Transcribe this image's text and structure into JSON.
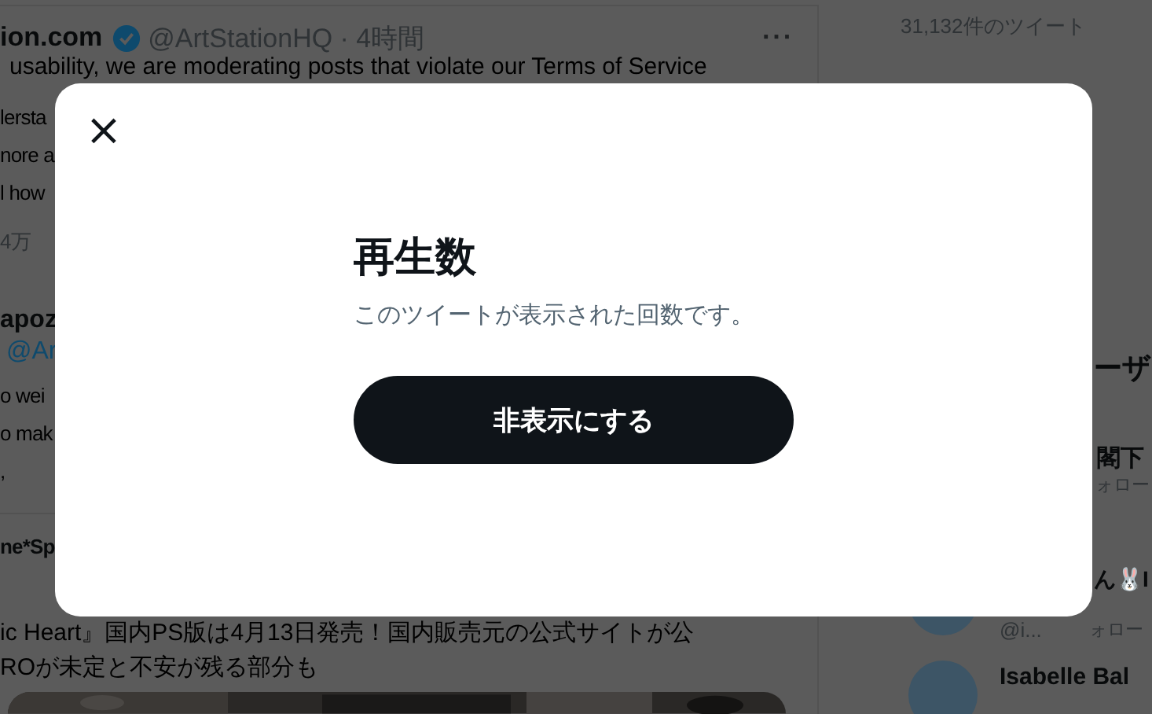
{
  "background": {
    "tweet": {
      "author": "ion.com",
      "handle_time": "@ArtStationHQ · 4時間",
      "more": "···",
      "lines": [
        "usability, we are moderating posts that violate our Terms of Service",
        "lersta",
        "nore a",
        "l how"
      ],
      "stat": "4万"
    },
    "reply": {
      "author": "apoz",
      "handle": "@Ar",
      "lines": [
        "o wei",
        "o mak",
        ","
      ]
    },
    "news": {
      "author": "ne*Sp",
      "lines": [
        "ic Heart』国内PS版は4月13日発売！国内販売元の公式サイトが公",
        "ROが未定と不安が残る部分も"
      ]
    },
    "sidebar": {
      "tweet_count": "31,132件のツイート",
      "heading": "ーザ",
      "users": [
        {
          "name": "閣下",
          "follow": "ォロー"
        },
        {
          "name": "ん🐰I",
          "handle": "@i...",
          "follow": "ォロー",
          "avatar": true
        },
        {
          "name": "Isabelle Bal",
          "avatar": true
        }
      ]
    }
  },
  "dialog": {
    "close": "×",
    "title": "再生数",
    "description": "このツイートが表示された回数です。",
    "button": "非表示にする"
  }
}
